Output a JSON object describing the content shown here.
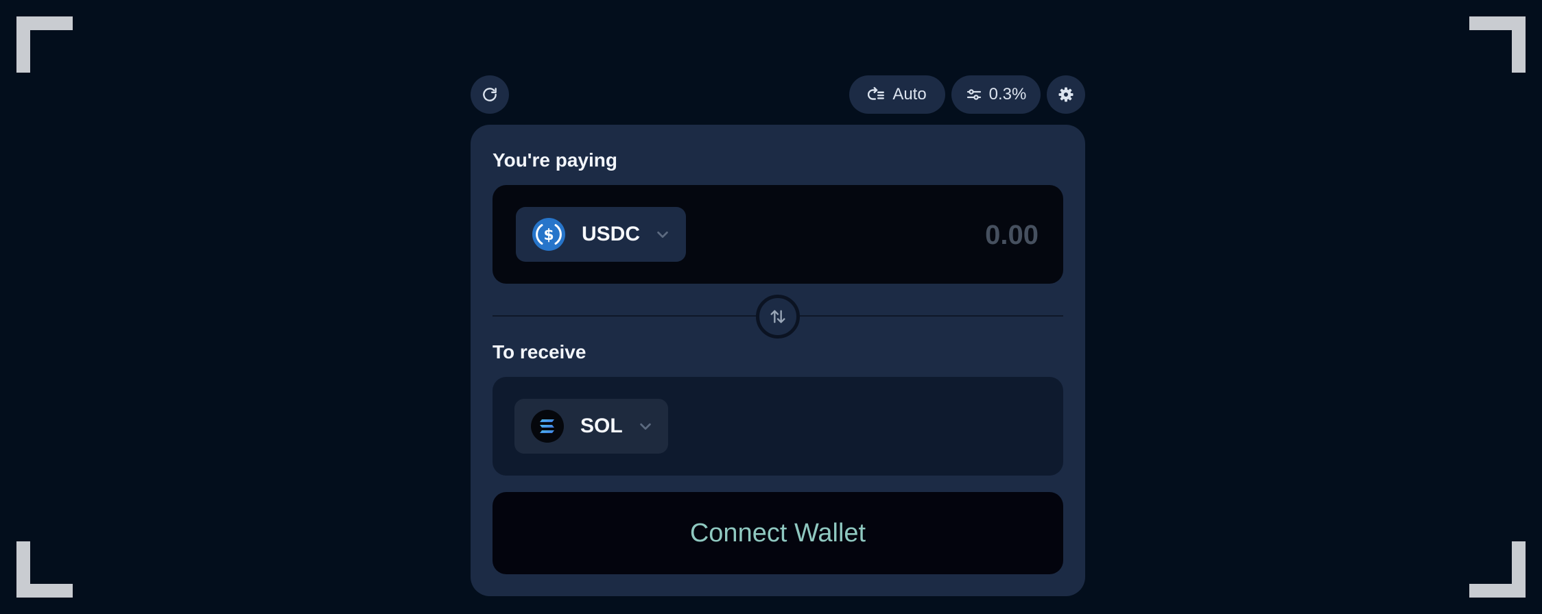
{
  "toolbar": {
    "refresh_icon": "refresh-icon",
    "routing_label": "Auto",
    "routing_icon": "route-list-icon",
    "slippage_label": "0.3%",
    "slippage_icon": "sliders-icon",
    "settings_icon": "gear-icon"
  },
  "pay": {
    "label": "You're paying",
    "token_symbol": "USDC",
    "token_icon": "usdc-icon",
    "amount_placeholder": "0.00"
  },
  "swap": {
    "icon": "swap-arrows-icon"
  },
  "receive": {
    "label": "To receive",
    "token_symbol": "SOL",
    "token_icon": "sol-icon"
  },
  "connect_button": {
    "label": "Connect Wallet"
  },
  "colors": {
    "background": "#030e1c",
    "card": "#1c2b45",
    "input_dark": "#04070f",
    "accent_text": "#8fc8c0",
    "usdc_blue": "#2775ca"
  }
}
